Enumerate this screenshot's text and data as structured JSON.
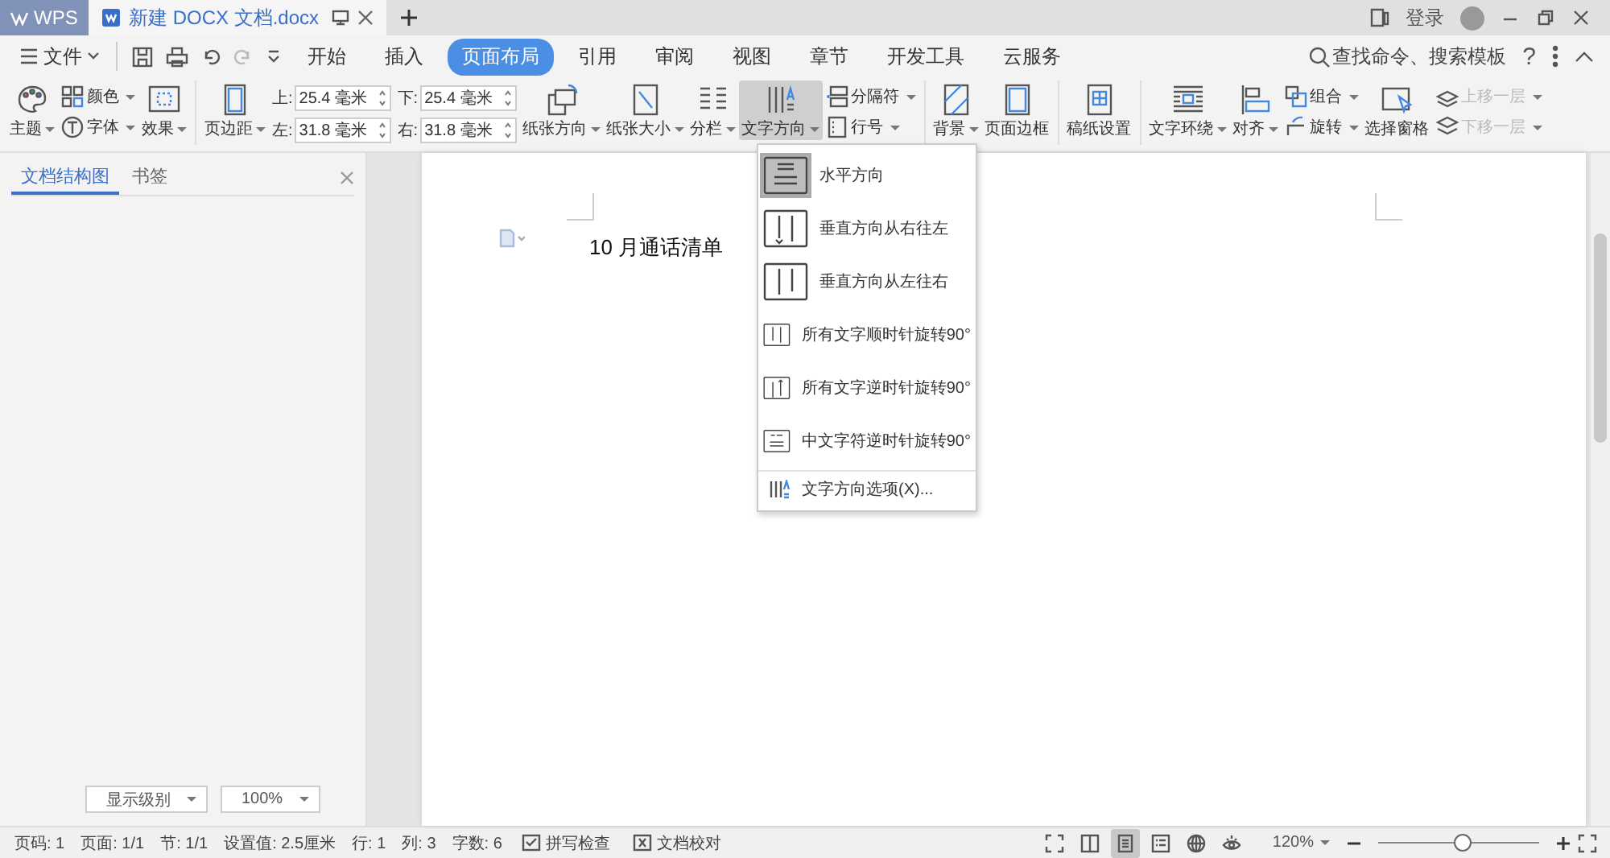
{
  "titlebar": {
    "app_tab": "WPS",
    "doc_tab": "新建 DOCX 文档.docx",
    "login": "登录"
  },
  "menubar": {
    "file": "文件",
    "tabs": [
      {
        "label": "开始",
        "selected": false
      },
      {
        "label": "插入",
        "selected": false
      },
      {
        "label": "页面布局",
        "selected": true
      },
      {
        "label": "引用",
        "selected": false
      },
      {
        "label": "审阅",
        "selected": false
      },
      {
        "label": "视图",
        "selected": false
      },
      {
        "label": "章节",
        "selected": false
      },
      {
        "label": "开发工具",
        "selected": false
      },
      {
        "label": "云服务",
        "selected": false
      }
    ],
    "search": "查找命令、搜索模板",
    "help": "?"
  },
  "ribbon": [
    {
      "kind": "large",
      "label": "主题",
      "dropdown": true,
      "active": false
    },
    {
      "kind": "stack",
      "items": [
        {
          "label": "颜色",
          "dropdown": true,
          "disabled": false
        },
        {
          "label": "字体",
          "dropdown": true,
          "disabled": false
        }
      ]
    },
    {
      "kind": "large",
      "label": "效果",
      "dropdown": true,
      "active": false
    },
    {
      "kind": "separator"
    },
    {
      "kind": "large",
      "label": "页边距",
      "dropdown": true,
      "active": false
    },
    {
      "kind": "fields",
      "items": [
        {
          "label": "上:",
          "value": "25.4 毫米"
        },
        {
          "label": "左:",
          "value": "31.8 毫米"
        }
      ]
    },
    {
      "kind": "fields",
      "items": [
        {
          "label": "下:",
          "value": "25.4 毫米"
        },
        {
          "label": "右:",
          "value": "31.8 毫米"
        }
      ]
    },
    {
      "kind": "large",
      "label": "纸张方向",
      "dropdown": true,
      "active": false
    },
    {
      "kind": "large",
      "label": "纸张大小",
      "dropdown": true,
      "active": false
    },
    {
      "kind": "large",
      "label": "分栏",
      "dropdown": true,
      "active": false
    },
    {
      "kind": "large",
      "label": "文字方向",
      "dropdown": true,
      "active": true
    },
    {
      "kind": "stack",
      "items": [
        {
          "label": "分隔符",
          "dropdown": true,
          "disabled": false
        },
        {
          "label": "行号",
          "dropdown": true,
          "disabled": false
        }
      ]
    },
    {
      "kind": "separator"
    },
    {
      "kind": "large",
      "label": "背景",
      "dropdown": true,
      "active": false
    },
    {
      "kind": "large",
      "label": "页面边框",
      "dropdown": false,
      "active": false
    },
    {
      "kind": "separator"
    },
    {
      "kind": "large",
      "label": "稿纸设置",
      "dropdown": false,
      "active": false
    },
    {
      "kind": "separator"
    },
    {
      "kind": "large",
      "label": "文字环绕",
      "dropdown": true,
      "active": false
    },
    {
      "kind": "large",
      "label": "对齐",
      "dropdown": true,
      "active": false
    },
    {
      "kind": "stack",
      "items": [
        {
          "label": "组合",
          "dropdown": true,
          "disabled": false
        },
        {
          "label": "旋转",
          "dropdown": true,
          "disabled": false
        }
      ]
    },
    {
      "kind": "large",
      "label": "选择窗格",
      "dropdown": false,
      "active": false
    },
    {
      "kind": "stack",
      "items": [
        {
          "label": "上移一层",
          "dropdown": true,
          "disabled": true
        },
        {
          "label": "下移一层",
          "dropdown": true,
          "disabled": true
        }
      ]
    }
  ],
  "left_panel": {
    "tabs": [
      {
        "label": "文档结构图",
        "selected": true
      },
      {
        "label": "书签",
        "selected": false
      }
    ],
    "level_select": "显示级别",
    "zoom_select": "100%"
  },
  "document": {
    "heading": "10 月通话清单"
  },
  "text_direction_menu": {
    "items": [
      {
        "label": "水平方向",
        "selected": true
      },
      {
        "label": "垂直方向从右往左",
        "selected": false
      },
      {
        "label": "垂直方向从左往右",
        "selected": false
      },
      {
        "label": "所有文字顺时针旋转90°",
        "selected": false
      },
      {
        "label": "所有文字逆时针旋转90°",
        "selected": false
      },
      {
        "label": "中文字符逆时针旋转90°",
        "selected": false
      }
    ],
    "options": "文字方向选项(X)..."
  },
  "status_bar": {
    "fields": [
      "页码: 1",
      "页面: 1/1",
      "节: 1/1",
      "设置值: 2.5厘米",
      "行: 1",
      "列: 3",
      "字数: 6"
    ],
    "buttons": [
      "拼写检查",
      "文档校对"
    ],
    "views": [
      {
        "selected": false
      },
      {
        "selected": false
      },
      {
        "selected": true
      },
      {
        "selected": false
      },
      {
        "selected": false
      },
      {
        "selected": false
      }
    ],
    "zoom": {
      "value": "120%",
      "level": 0.52
    }
  }
}
